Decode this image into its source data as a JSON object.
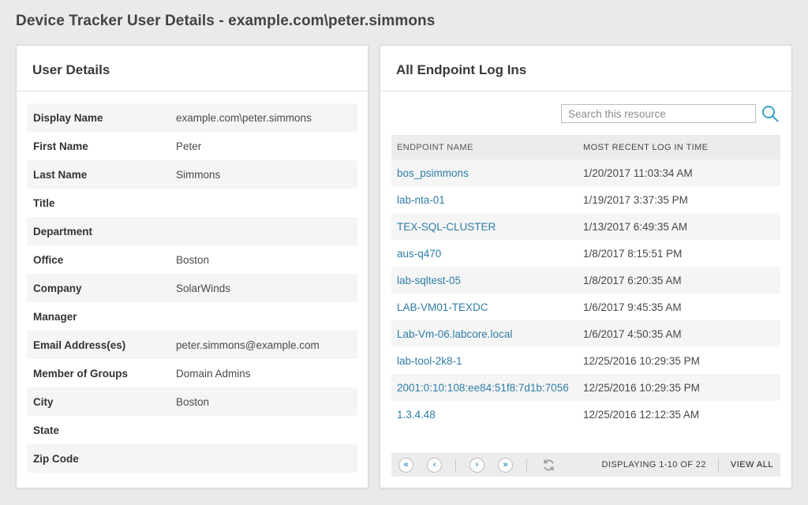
{
  "page": {
    "title": "Device Tracker User Details - example.com\\peter.simmons"
  },
  "user_details": {
    "title": "User Details",
    "rows": [
      {
        "label": "Display Name",
        "value": "example.com\\peter.simmons"
      },
      {
        "label": "First Name",
        "value": "Peter"
      },
      {
        "label": "Last Name",
        "value": "Simmons"
      },
      {
        "label": "Title",
        "value": ""
      },
      {
        "label": "Department",
        "value": ""
      },
      {
        "label": "Office",
        "value": "Boston"
      },
      {
        "label": "Company",
        "value": "SolarWinds"
      },
      {
        "label": "Manager",
        "value": ""
      },
      {
        "label": "Email Address(es)",
        "value": "peter.simmons@example.com"
      },
      {
        "label": "Member of Groups",
        "value": "Domain Admins"
      },
      {
        "label": "City",
        "value": "Boston"
      },
      {
        "label": "State",
        "value": ""
      },
      {
        "label": "Zip Code",
        "value": ""
      }
    ]
  },
  "endpoint_logins": {
    "title": "All Endpoint Log Ins",
    "search_placeholder": "Search this resource",
    "columns": [
      "ENDPOINT NAME",
      "MOST RECENT LOG IN TIME"
    ],
    "rows": [
      {
        "endpoint": "bos_psimmons",
        "time": "1/20/2017 11:03:34 AM"
      },
      {
        "endpoint": "lab-nta-01",
        "time": "1/19/2017 3:37:35 PM"
      },
      {
        "endpoint": "TEX-SQL-CLUSTER",
        "time": "1/13/2017 6:49:35 AM"
      },
      {
        "endpoint": "aus-q470",
        "time": "1/8/2017 8:15:51 PM"
      },
      {
        "endpoint": "lab-sqltest-05",
        "time": "1/8/2017 6:20:35 AM"
      },
      {
        "endpoint": "LAB-VM01-TEXDC",
        "time": "1/6/2017 9:45:35 AM"
      },
      {
        "endpoint": "Lab-Vm-06.labcore.local",
        "time": "1/6/2017 4:50:35 AM"
      },
      {
        "endpoint": "lab-tool-2k8-1",
        "time": "12/25/2016 10:29:35 PM"
      },
      {
        "endpoint": "2001:0:10:108:ee84:51f8:7d1b:7056",
        "time": "12/25/2016 10:29:35 PM"
      },
      {
        "endpoint": "1.3.4.48",
        "time": "12/25/2016 12:12:35 AM"
      }
    ],
    "pagination": {
      "first_icon": "«",
      "prev_icon": "‹",
      "next_icon": "›",
      "last_icon": "»",
      "displaying": "DISPLAYING 1-10 OF 22",
      "view_all": "VIEW ALL"
    }
  },
  "colors": {
    "link": "#2e7da6",
    "accent": "#3aa0c8",
    "pager_chevron": "#3a97c2",
    "refresh_gray": "#9c9c9c"
  }
}
